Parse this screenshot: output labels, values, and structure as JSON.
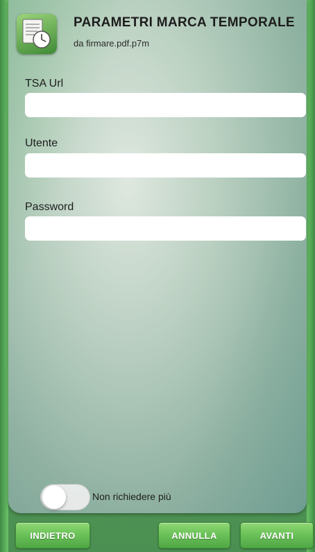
{
  "header": {
    "title": "PARAMETRI MARCA TEMPORALE",
    "subtitle": "da firmare.pdf.p7m",
    "icon": "document-clock-icon"
  },
  "form": {
    "tsa_url_label": "TSA Url",
    "tsa_url_value": "",
    "user_label": "Utente",
    "user_value": "",
    "password_label": "Password",
    "password_value": ""
  },
  "toggle": {
    "label": "Non richiedere più",
    "state": "off"
  },
  "buttons": {
    "back_label": "INDIETRO",
    "cancel_label": "ANNULLA",
    "next_label": "AVANTI"
  },
  "colors": {
    "accent": "#6cc25a",
    "frame": "#4fa745"
  }
}
